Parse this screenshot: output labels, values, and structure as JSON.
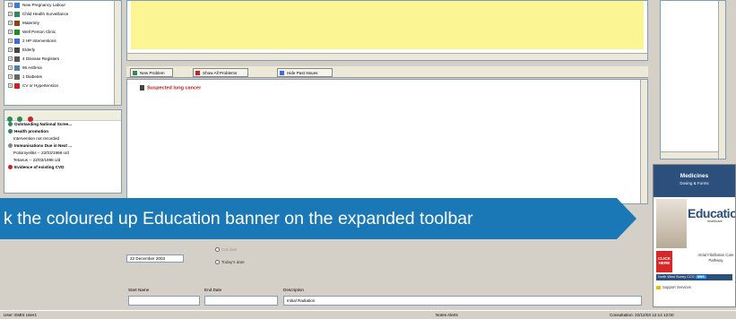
{
  "tree": {
    "items": [
      {
        "label": "New Pregnancy Labour",
        "icon": "pregnancy-icon",
        "color": "#3a7bd5"
      },
      {
        "label": "Child Health Surveillance",
        "icon": "child-health-icon",
        "color": "#2e8b57"
      },
      {
        "label": "Maternity",
        "icon": "maternity-icon",
        "color": "#8b4513"
      },
      {
        "label": "Well Person Clinic",
        "icon": "well-person-icon",
        "color": "#228b22"
      },
      {
        "label": "2 HP Interventions",
        "icon": "interventions-icon",
        "color": "#4169e1"
      },
      {
        "label": "Elderly",
        "icon": "elderly-icon",
        "color": "#444444"
      },
      {
        "label": "4 Disease Registers",
        "icon": "registers-icon",
        "color": "#555555"
      },
      {
        "label": "96 Asthma",
        "icon": "asthma-icon",
        "color": "#4682b4"
      },
      {
        "label": "1 Diabetes",
        "icon": "diabetes-icon",
        "color": "#666666"
      },
      {
        "label": "CV or Hypertension",
        "icon": "heart-icon",
        "color": "#cc2222"
      }
    ]
  },
  "alerts": {
    "rows": [
      {
        "text": "Outstanding National Scree...",
        "bold": true,
        "dot": "#2e8b57"
      },
      {
        "text": "Health promotion",
        "bold": true,
        "dot": "#2e8b57"
      },
      {
        "text": "Intervention not recorded",
        "bold": false,
        "dot": ""
      },
      {
        "text": "Immunisations Due in Next ...",
        "bold": true,
        "dot": "#888888"
      },
      {
        "text": "Poliomyelitis -- 22/03/1998 o/d",
        "bold": false,
        "dot": ""
      },
      {
        "text": "Tetanus -- 22/03/1998 o/d",
        "bold": false,
        "dot": ""
      },
      {
        "text": "Evidence of existing CVD",
        "bold": true,
        "dot": "#cc2222"
      }
    ]
  },
  "toolbar": {
    "new_problem": "New Problem",
    "show_all": "Show All Problems",
    "hide_past": "Hide Past Issues"
  },
  "problems": {
    "row1": "Suspected lung cancer"
  },
  "form": {
    "date_value": "22 December 2003",
    "radio_disabled": "Cut date",
    "radio_today": "Today's date",
    "start_name_label": "Start Name",
    "end_date_label": "End Date",
    "description_label": "Description",
    "description_value": "Initial Radiation"
  },
  "education": {
    "medicines_title": "Medicines",
    "medicines_sub": "Dosing & Forms",
    "title": "Education",
    "subtitle": "healthcare",
    "click_label": "CLICK HERE",
    "desc": "Atrial Fibrillation Care Pathway",
    "footer": "North West Surrey CCG",
    "footer_tag": "NHS",
    "support": "Support Services"
  },
  "status": {
    "left": "User: EMIS User1",
    "middle": "Notes  Alerts",
    "right": "Consultation: 22/12/03  12:14  12:00"
  },
  "callout": {
    "text": "k the coloured up Education banner on the expanded toolbar"
  },
  "colors": {
    "callout": "#1a78b6",
    "notes": "#fbf593",
    "problem": "#b22222",
    "education_blue": "#2c4f7c"
  }
}
